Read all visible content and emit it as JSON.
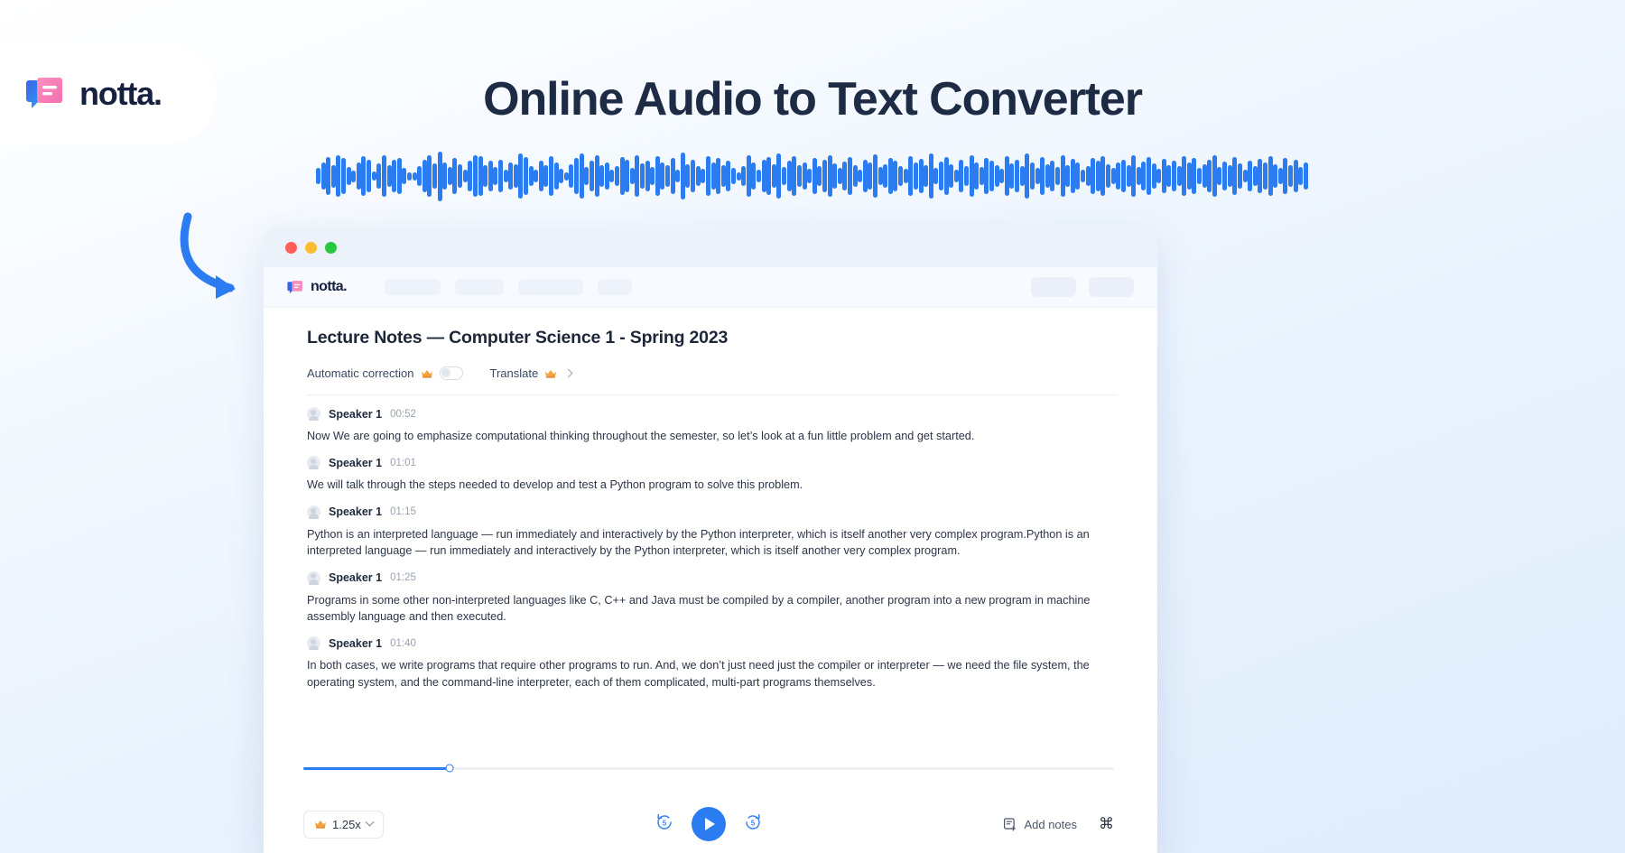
{
  "brand": {
    "name": "notta.",
    "logo_icon": "notta-logo-icon"
  },
  "hero": {
    "title": "Online Audio to Text Converter",
    "waveform_heights": [
      18,
      30,
      42,
      25,
      46,
      40,
      20,
      13,
      30,
      44,
      36,
      10,
      28,
      46,
      24,
      36,
      40,
      18,
      9,
      9,
      22,
      36,
      46,
      28,
      55,
      30,
      20,
      40,
      26,
      14,
      34,
      46,
      44,
      24,
      34,
      20,
      36,
      14,
      30,
      26,
      50,
      42,
      22,
      14,
      34,
      24,
      44,
      30,
      16,
      9,
      26,
      40,
      50,
      20,
      34,
      46,
      24,
      30,
      14,
      22,
      42,
      36,
      18,
      46,
      28,
      34,
      20,
      44,
      30,
      24,
      40,
      14,
      52,
      26,
      36,
      22,
      16,
      44,
      30,
      40,
      24,
      34,
      18,
      9,
      22,
      46,
      30,
      14,
      36,
      42,
      26,
      50,
      20,
      34,
      44,
      24,
      30,
      16,
      40,
      22,
      36,
      46,
      28,
      18,
      32,
      42,
      24,
      14,
      36,
      30,
      48,
      20,
      26,
      40,
      34,
      22,
      16,
      44,
      30,
      38,
      24,
      50,
      18,
      32,
      42,
      26,
      14,
      36,
      22,
      46,
      30,
      20,
      40,
      34,
      24,
      16,
      44,
      28,
      36,
      22,
      50,
      30,
      18,
      42,
      26,
      34,
      20,
      46,
      24,
      38,
      30,
      14,
      22,
      40,
      34,
      44,
      26,
      18,
      30,
      36,
      24,
      46,
      20,
      32,
      42,
      28,
      16,
      38,
      24,
      34,
      22,
      44,
      30,
      40,
      18,
      26,
      36,
      46,
      20,
      32,
      24,
      42,
      28,
      14,
      34,
      22,
      38,
      30,
      44,
      26,
      18,
      40,
      24,
      36,
      20,
      30
    ],
    "waveform_color": "#2b7cf0"
  },
  "window": {
    "traffic_lights": [
      "close-button",
      "minimize-button",
      "maximize-button"
    ],
    "traffic_colors": {
      "red": "#ff5f57",
      "yellow": "#febc2e",
      "green": "#28c840"
    },
    "nav": {
      "logo_text": "notta.",
      "placeholder_pill_widths": [
        62,
        54,
        72,
        38
      ],
      "right_pill_count": 2
    }
  },
  "document": {
    "title": "Lecture Notes — Computer Science 1 - Spring 2023",
    "tools": [
      {
        "label": "Automatic correction",
        "badge_icon": "crown-icon",
        "control": "toggle",
        "toggle_on": false
      },
      {
        "label": "Translate",
        "badge_icon": "crown-icon",
        "control": "chevron",
        "toggle_on": false
      }
    ],
    "segments": [
      {
        "speaker": "Speaker 1",
        "time": "00:52",
        "text": "Now We are going to emphasize computational thinking throughout the semester, so let’s look at a fun little problem and get started."
      },
      {
        "speaker": "Speaker 1",
        "time": "01:01",
        "text": "We will talk through the steps needed to develop and test a Python program to solve this problem."
      },
      {
        "speaker": "Speaker 1",
        "time": "01:15",
        "text": "Python is an interpreted language — run immediately and interactively by the Python interpreter, which is itself another very complex program.Python is an interpreted language — run immediately and interactively by the Python interpreter, which is itself another very complex program."
      },
      {
        "speaker": "Speaker 1",
        "time": "01:25",
        "text": "Programs in some other non-interpreted languages like C, C++ and Java must be compiled by a compiler, another program into a new program in machine assembly language and then executed."
      },
      {
        "speaker": "Speaker 1",
        "time": "01:40",
        "text": "In both cases, we write programs that require other programs to run. And, we don’t just need just the compiler or interpreter — we need the file system, the operating system, and the command-line interpreter, each of them complicated, multi-part programs themselves."
      }
    ]
  },
  "player": {
    "progress_percent": 18,
    "progress_color": "#2b7cf0",
    "speed": {
      "value": "1.25x",
      "badge_icon": "crown-icon",
      "chevron_icon": "chevron-down-icon"
    },
    "rewind_label": "5",
    "forward_label": "5",
    "rewind_icon": "rewind-5-icon",
    "forward_icon": "forward-5-icon",
    "play_icon": "play-icon",
    "add_notes": {
      "label": "Add notes",
      "icon": "note-plus-icon"
    },
    "shortcut_icon": "command-key-icon",
    "shortcut_glyph": "⌘"
  }
}
